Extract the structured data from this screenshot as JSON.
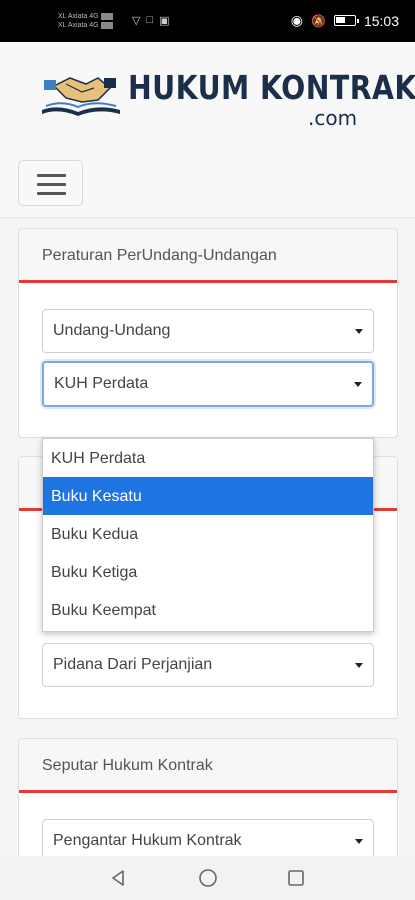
{
  "status_bar": {
    "carrier_line1": "XL Axiata 4G",
    "carrier_line2": "XL Axiata 4G",
    "time": "15:03"
  },
  "header": {
    "logo_title": "HUKUM KONTRAK",
    "logo_sub": ".com",
    "menu_icon": "hamburger-icon"
  },
  "card_peraturan": {
    "title": "Peraturan PerUndang-Undangan",
    "select1_value": "Undang-Undang",
    "select2_value": "KUH Perdata"
  },
  "dropdown": {
    "options": [
      "KUH Perdata",
      "Buku Kesatu",
      "Buku Kedua",
      "Buku Ketiga",
      "Buku Keempat"
    ],
    "selected_index": 1
  },
  "card_second": {
    "select_value": "Pidana Dari Perjanjian"
  },
  "card_seputar": {
    "title": "Seputar Hukum Kontrak",
    "select_value": "Pengantar Hukum Kontrak"
  },
  "colors": {
    "accent_red": "#e53935",
    "selection_blue": "#1e74e0",
    "logo_navy": "#1b2e4a"
  },
  "nav": {
    "back_icon": "back-triangle-icon",
    "home_icon": "home-circle-icon",
    "recents_icon": "recents-square-icon"
  }
}
